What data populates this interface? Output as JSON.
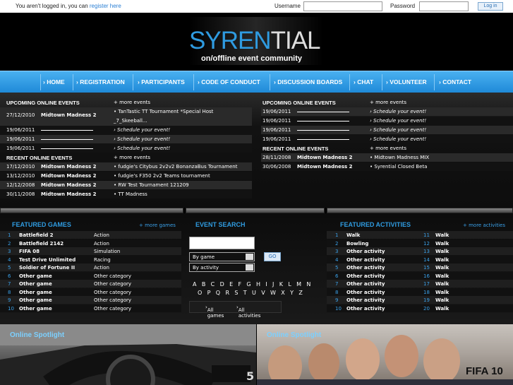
{
  "top": {
    "logged_msg": "You aren't logged in, you can ",
    "register_link": "register here",
    "username_label": "Username",
    "password_label": "Password",
    "login_button": "Log in"
  },
  "brand": {
    "logo_a": "SYREN",
    "logo_b": "TIAL",
    "tagline": "on/offline event community"
  },
  "nav": [
    "HOME",
    "REGISTRATION",
    "PARTICIPANTS",
    "CODE OF CONDUCT",
    "DISCUSSION BOARDS",
    "CHAT",
    "VOLUNTEER",
    "CONTACT"
  ],
  "left": {
    "upcoming_title": "UPCOMING ONLINE EVENTS",
    "upcoming_more": "+ more events",
    "upcoming": [
      {
        "date": "27/12/2010",
        "event": "Midtown Madness 2",
        "right": "TanTastic TT Tournament *Special Host",
        "right2": "_7_Skeeball..."
      },
      {
        "date": "19/06/2011",
        "event": "",
        "right": "Schedule your event!"
      },
      {
        "date": "19/06/2011",
        "event": "",
        "right": "Schedule your event!"
      },
      {
        "date": "19/06/2011",
        "event": "",
        "right": "Schedule your event!"
      }
    ],
    "recent_title": "RECENT ONLINE EVENTS",
    "recent_more": "+ more events",
    "recent": [
      {
        "date": "17/12/2010",
        "event": "Midtown Madness 2",
        "right": "fudgie's Citybus 2v2v2 BonanzaBus Tournament"
      },
      {
        "date": "13/12/2010",
        "event": "Midtown Madness 2",
        "right": "fudgie's F350 2v2 Teams tournament"
      },
      {
        "date": "12/12/2008",
        "event": "Midtown Madness 2",
        "right": "RW Test Tournament 121209"
      },
      {
        "date": "30/11/2008",
        "event": "Midtown Madness 2",
        "right": "TT Madness"
      }
    ]
  },
  "right": {
    "upcoming_title": "UPCOMING ONLINE EVENTS",
    "upcoming_more": "+ more events",
    "upcoming": [
      {
        "date": "19/06/2011",
        "right": "Schedule your event!"
      },
      {
        "date": "19/06/2011",
        "right": "Schedule your event!"
      },
      {
        "date": "19/06/2011",
        "right": "Schedule your event!"
      },
      {
        "date": "19/06/2011",
        "right": "Schedule your event!"
      }
    ],
    "recent_title": "RECENT ONLINE EVENTS",
    "recent_more": "+ more events",
    "recent": [
      {
        "date": "28/11/2008",
        "event": "Midtown Madness 2",
        "right": "Midtown Madness MIX"
      },
      {
        "date": "30/06/2008",
        "event": "Midtown Madness 2",
        "right": "Syrential Closed Beta"
      }
    ]
  },
  "games": {
    "title": "FEATURED GAMES",
    "more": "+ more games",
    "items": [
      {
        "n": "1",
        "t": "Battlefield 2",
        "c": "Action"
      },
      {
        "n": "2",
        "t": "Battlefield 2142",
        "c": "Action"
      },
      {
        "n": "3",
        "t": "FIFA 08",
        "c": "Simulation"
      },
      {
        "n": "4",
        "t": "Test Drive Unlimited",
        "c": "Racing"
      },
      {
        "n": "5",
        "t": "Soldier of Fortune II",
        "c": "Action"
      },
      {
        "n": "6",
        "t": "Other game",
        "c": "Other category"
      },
      {
        "n": "7",
        "t": "Other game",
        "c": "Other category"
      },
      {
        "n": "8",
        "t": "Other game",
        "c": "Other category"
      },
      {
        "n": "9",
        "t": "Other game",
        "c": "Other category"
      },
      {
        "n": "10",
        "t": "Other game",
        "c": "Other category"
      }
    ]
  },
  "search": {
    "title": "EVENT SEARCH",
    "by_game": "By game",
    "by_activity": "By activity",
    "go": "GO",
    "alpha1": "A B C D E F G H I J K L M N",
    "alpha2": "O P Q R S T U V W X Y Z",
    "all_games": "All games",
    "all_activities": "All activities"
  },
  "activities": {
    "title": "FEATURED ACTIVITIES",
    "more": "+ more activities",
    "left": [
      {
        "n": "1",
        "t": "Walk"
      },
      {
        "n": "2",
        "t": "Bowling"
      },
      {
        "n": "3",
        "t": "Other activity"
      },
      {
        "n": "4",
        "t": "Other activity"
      },
      {
        "n": "5",
        "t": "Other activity"
      },
      {
        "n": "6",
        "t": "Other activity"
      },
      {
        "n": "7",
        "t": "Other activity"
      },
      {
        "n": "8",
        "t": "Other activity"
      },
      {
        "n": "9",
        "t": "Other activity"
      },
      {
        "n": "10",
        "t": "Other activity"
      }
    ],
    "right": [
      {
        "n": "11",
        "t": "Walk"
      },
      {
        "n": "12",
        "t": "Walk"
      },
      {
        "n": "13",
        "t": "Walk"
      },
      {
        "n": "14",
        "t": "Walk"
      },
      {
        "n": "15",
        "t": "Walk"
      },
      {
        "n": "16",
        "t": "Walk"
      },
      {
        "n": "17",
        "t": "Walk"
      },
      {
        "n": "18",
        "t": "Walk"
      },
      {
        "n": "19",
        "t": "Walk"
      },
      {
        "n": "20",
        "t": "Walk"
      }
    ]
  },
  "spotlight": {
    "left_label": "Online Spotlight",
    "right_label": "Online Spotlight",
    "left_badge": "5",
    "right_badge": "FIFA 10"
  }
}
